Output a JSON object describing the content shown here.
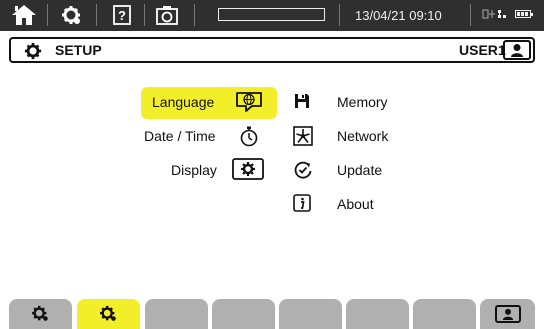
{
  "status_bar": {
    "datetime": "13/04/21 09:10",
    "icons": [
      "home-icon",
      "gear-icon",
      "help-icon",
      "camera-icon",
      "usb-icon",
      "network-icon",
      "battery-icon"
    ],
    "help_glyph": "?"
  },
  "header": {
    "title": "SETUP",
    "user": "USER1"
  },
  "menu": {
    "left": [
      {
        "label": "Language",
        "icon": "language-icon",
        "selected": true
      },
      {
        "label": "Date / Time",
        "icon": "stopwatch-icon"
      },
      {
        "label": "Display",
        "icon": "display-icon"
      }
    ],
    "right": [
      {
        "label": "Memory",
        "icon": "floppy-icon"
      },
      {
        "label": "Network",
        "icon": "network-icon"
      },
      {
        "label": "Update",
        "icon": "update-icon"
      },
      {
        "label": "About",
        "icon": "info-icon"
      }
    ]
  },
  "tabs": {
    "count": 8,
    "active_index": 1,
    "active_color": "#f2ef2a",
    "inactive_color": "#b0b0b0"
  },
  "colors": {
    "accent": "#f2ef2a",
    "topbar": "#2f2f2f"
  }
}
